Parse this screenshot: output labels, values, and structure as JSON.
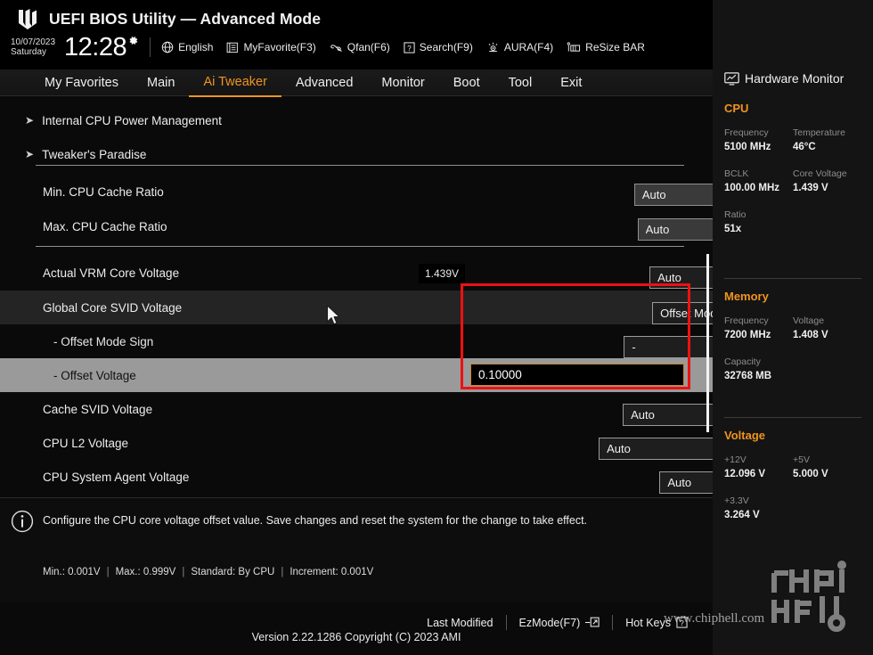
{
  "header": {
    "app_title": "UEFI BIOS Utility — Advanced Mode",
    "logo_icon": "tuf-gaming-logo",
    "date": "10/07/2023",
    "weekday": "Saturday",
    "time": "12:28",
    "gear_icon": "gear-icon",
    "tools": [
      {
        "label": "English",
        "icon": "globe-icon"
      },
      {
        "label": "MyFavorite(F3)",
        "icon": "favorite-icon"
      },
      {
        "label": "Qfan(F6)",
        "icon": "fan-icon"
      },
      {
        "label": "Search(F9)",
        "icon": "question-box-icon"
      },
      {
        "label": "AURA(F4)",
        "icon": "aura-light-icon"
      },
      {
        "label": "ReSize BAR",
        "icon": "resize-bar-icon"
      }
    ]
  },
  "nav": {
    "items": [
      {
        "label": "My Favorites",
        "active": false
      },
      {
        "label": "Main",
        "active": false
      },
      {
        "label": "Ai Tweaker",
        "active": true
      },
      {
        "label": "Advanced",
        "active": false
      },
      {
        "label": "Monitor",
        "active": false
      },
      {
        "label": "Boot",
        "active": false
      },
      {
        "label": "Tool",
        "active": false
      },
      {
        "label": "Exit",
        "active": false
      }
    ],
    "accent_color": "#f0941e"
  },
  "settings": {
    "submenus": [
      {
        "label": "Internal CPU Power Management"
      },
      {
        "label": "Tweaker's Paradise"
      }
    ],
    "rows": [
      {
        "label": "Min. CPU Cache Ratio",
        "value": "Auto",
        "control": "select-filled"
      },
      {
        "label": "Max. CPU Cache Ratio",
        "value": "Auto",
        "control": "select-filled"
      },
      {
        "label": "Actual VRM Core Voltage",
        "value": "Auto",
        "control": "select",
        "readout": "1.439V"
      },
      {
        "label": "Global Core SVID Voltage",
        "value": "Offset Mode",
        "control": "select",
        "highlight": "dark"
      },
      {
        "label": "- Offset Mode Sign",
        "value": "-",
        "control": "select"
      },
      {
        "label": "- Offset Voltage",
        "value": "0.10000",
        "control": "textbox",
        "highlight": "light"
      },
      {
        "label": "Cache SVID Voltage",
        "value": "Auto",
        "control": "select"
      },
      {
        "label": "CPU L2 Voltage",
        "value": "Auto",
        "control": "select"
      },
      {
        "label": "CPU System Agent Voltage",
        "value": "Auto",
        "control": "select"
      }
    ],
    "annotation_color": "#ee1111"
  },
  "help": {
    "info_icon": "info-icon",
    "description": "Configure the CPU core voltage offset value. Save changes and reset the system for the change to take effect.",
    "constraints": [
      "Min.: 0.001V",
      "Max.: 0.999V",
      "Standard: By CPU",
      "Increment: 0.001V"
    ]
  },
  "footer": {
    "buttons": [
      {
        "label": "Last Modified",
        "icon": ""
      },
      {
        "label": "EzMode(F7)",
        "icon": "arrow-box-icon"
      },
      {
        "label": "Hot Keys",
        "icon": "question-box-icon"
      }
    ],
    "version": "Version 2.22.1286 Copyright (C) 2023 AMI"
  },
  "hardware_monitor": {
    "title": "Hardware Monitor",
    "monitor_icon": "monitor-chart-icon",
    "sections": [
      {
        "title": "CPU",
        "items": [
          {
            "key": "Frequency",
            "value": "5100 MHz"
          },
          {
            "key": "Temperature",
            "value": "46°C"
          },
          {
            "key": "BCLK",
            "value": "100.00 MHz"
          },
          {
            "key": "Core Voltage",
            "value": "1.439 V"
          },
          {
            "key": "Ratio",
            "value": "51x"
          }
        ]
      },
      {
        "title": "Memory",
        "items": [
          {
            "key": "Frequency",
            "value": "7200 MHz"
          },
          {
            "key": "Voltage",
            "value": "1.408 V"
          },
          {
            "key": "Capacity",
            "value": "32768 MB"
          }
        ]
      },
      {
        "title": "Voltage",
        "items": [
          {
            "key": "+12V",
            "value": "12.096 V"
          },
          {
            "key": "+5V",
            "value": "5.000 V"
          },
          {
            "key": "+3.3V",
            "value": "3.264 V"
          }
        ]
      }
    ]
  },
  "watermark": {
    "url": "www.chiphell.com",
    "logo_icon": "chiphell-logo"
  }
}
